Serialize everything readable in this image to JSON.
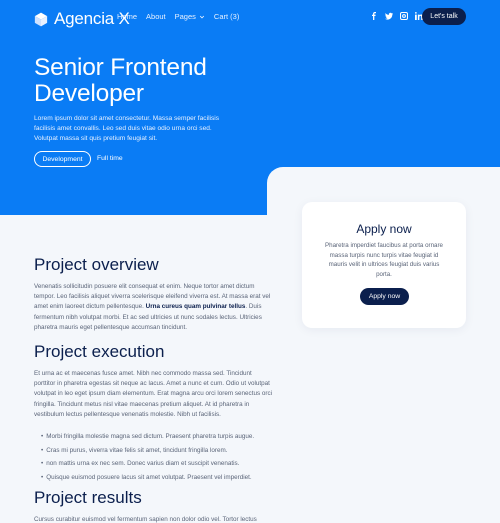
{
  "brand": {
    "name": "Agencia X"
  },
  "nav": {
    "items": [
      "Home",
      "About",
      "Pages",
      "Cart (3)"
    ],
    "cta": "Let's talk",
    "social_icons": [
      "facebook-icon",
      "twitter-icon",
      "instagram-icon",
      "linkedin-icon"
    ]
  },
  "hero": {
    "title_line1": "Senior Frontend",
    "title_line2": "Developer",
    "description": "Lorem ipsum dolor sit amet consectetur. Massa semper facilisis facilisis amet convallis. Leo sed duis vitae odio urna orci sed. Volutpat massa sit quis pretium feugiat sit.",
    "tag_button": "Development",
    "tag_text": "Full time"
  },
  "apply": {
    "title": "Apply now",
    "description": "Pharetra imperdiet faucibus at porta ornare massa turpis nunc turpis vitae feugiat id mauris velit in ultrices feugiat duis varius porta.",
    "button": "Apply now"
  },
  "overview": {
    "title": "Project overview",
    "text_before": "Venenatis sollicitudin posuere elit consequat et enim. Neque tortor amet dictum tempor. Leo facilisis aliquet viverra scelerisque eleifend viverra est. At massa erat vel amet enim laoreet dictum pellentesque. ",
    "text_bold": "Urna cureus quam pulvinar tellus",
    "text_after": ". Duis fermentum nibh volutpat morbi. Et ac sed ultricies ut nunc sodales lectus. Ultricies pharetra mauris eget pellentesque accumsan tincidunt."
  },
  "execution": {
    "title": "Project execution",
    "text": "Et urna ac et maecenas fusce amet. Nibh nec commodo massa sed. Tincidunt porttitor in pharetra egestas sit neque ac lacus. Amet a nunc et cum. Odio ut volutpat volutpat in leo eget ipsum diam elementum. Erat magna arcu orci lorem senectus orci fringilla. Tincidunt metus nisl vitae maecenas pretium aliquet. At id pharetra in vestibulum lectus pellentesque venenatis molestie. Nibh ut facilisis.",
    "bullets": [
      "Morbi fringilla molestie magna sed dictum. Praesent pharetra turpis augue.",
      "Cras mi purus, viverra vitae felis sit amet, tincidunt fringilla lorem.",
      "non mattis urna ex nec sem. Donec varius diam et suscipit venenatis.",
      "Quisque euismod posuere lacus sit amet volutpat. Praesent vel imperdiet."
    ]
  },
  "results": {
    "title": "Project results",
    "text": "Cursus curabitur euismod vel fermentum sapien non dolor odio vel. Tortor lectus"
  },
  "colors": {
    "primary": "#0a7cf5",
    "dark": "#0b1f4d",
    "background": "#f4f7fb"
  }
}
